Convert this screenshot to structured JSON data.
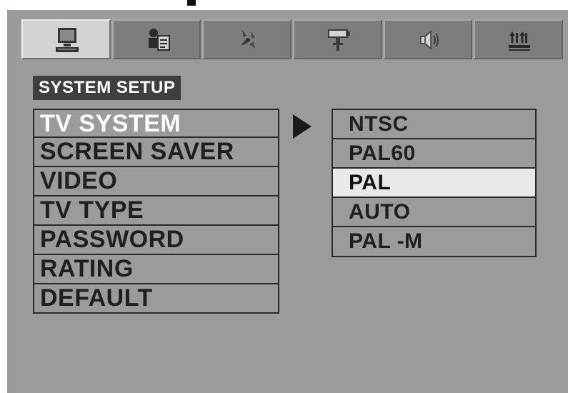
{
  "tabs": [
    {
      "name": "system-tab",
      "icon": "monitor-icon",
      "active": true
    },
    {
      "name": "language-tab",
      "icon": "language-icon",
      "active": false
    },
    {
      "name": "audio-tab",
      "icon": "audio-icon",
      "active": false
    },
    {
      "name": "video-tab",
      "icon": "video-icon",
      "active": false
    },
    {
      "name": "speaker-tab",
      "icon": "speaker-icon",
      "active": false
    },
    {
      "name": "digital-tab",
      "icon": "digital-icon",
      "active": false
    }
  ],
  "section_title": "SYSTEM SETUP",
  "menu": {
    "items": [
      "TV SYSTEM",
      "SCREEN SAVER",
      "VIDEO",
      "TV TYPE",
      "PASSWORD",
      "RATING",
      "DEFAULT"
    ],
    "selected_index": 0
  },
  "submenu": {
    "options": [
      "NTSC",
      "PAL60",
      "PAL",
      "AUTO",
      "PAL -M"
    ],
    "highlighted_index": 2
  },
  "colors": {
    "background": "#9b9b9b",
    "highlight": "#e9e9e9",
    "text": "#1f1f1f",
    "selected_text": "#ffffff"
  }
}
